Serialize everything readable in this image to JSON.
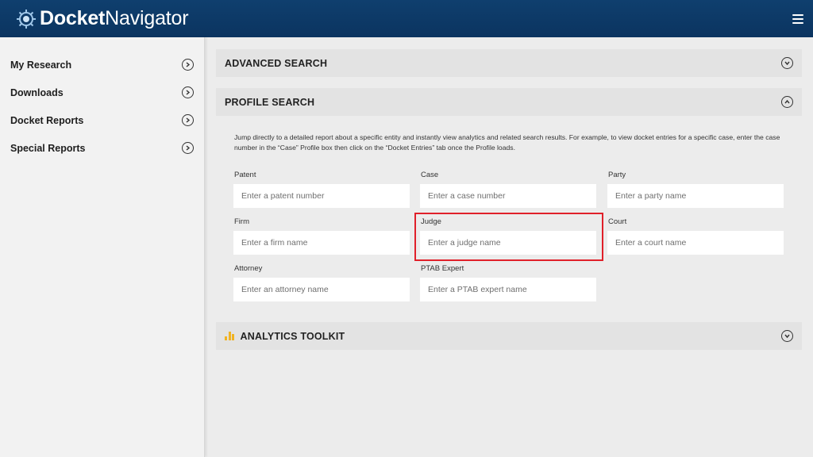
{
  "header": {
    "logo_bold": "Docket",
    "logo_light": "Navigator"
  },
  "sidebar": {
    "items": [
      {
        "label": "My Research"
      },
      {
        "label": "Downloads"
      },
      {
        "label": "Docket Reports"
      },
      {
        "label": "Special Reports"
      }
    ]
  },
  "panels": {
    "advanced_search": "ADVANCED SEARCH",
    "profile_search": "PROFILE SEARCH",
    "analytics_toolkit": "ANALYTICS TOOLKIT"
  },
  "profile": {
    "description": "Jump directly to a detailed report about a specific entity and instantly view analytics and related search results. For example, to view docket entries for a specific case, enter the case number in the “Case” Profile box then click on the “Docket Entries” tab once the Profile loads.",
    "fields": [
      {
        "label": "Patent",
        "placeholder": "Enter a patent number"
      },
      {
        "label": "Case",
        "placeholder": "Enter a case number"
      },
      {
        "label": "Party",
        "placeholder": "Enter a party name"
      },
      {
        "label": "Firm",
        "placeholder": "Enter a firm name"
      },
      {
        "label": "Judge",
        "placeholder": "Enter a judge name"
      },
      {
        "label": "Court",
        "placeholder": "Enter a court name"
      },
      {
        "label": "Attorney",
        "placeholder": "Enter an attorney name"
      },
      {
        "label": "PTAB Expert",
        "placeholder": "Enter a PTAB expert name"
      }
    ]
  },
  "colors": {
    "header_bg": "#0f3f6e",
    "highlight": "#e0202a",
    "analytics_icon": "#f0b323"
  }
}
